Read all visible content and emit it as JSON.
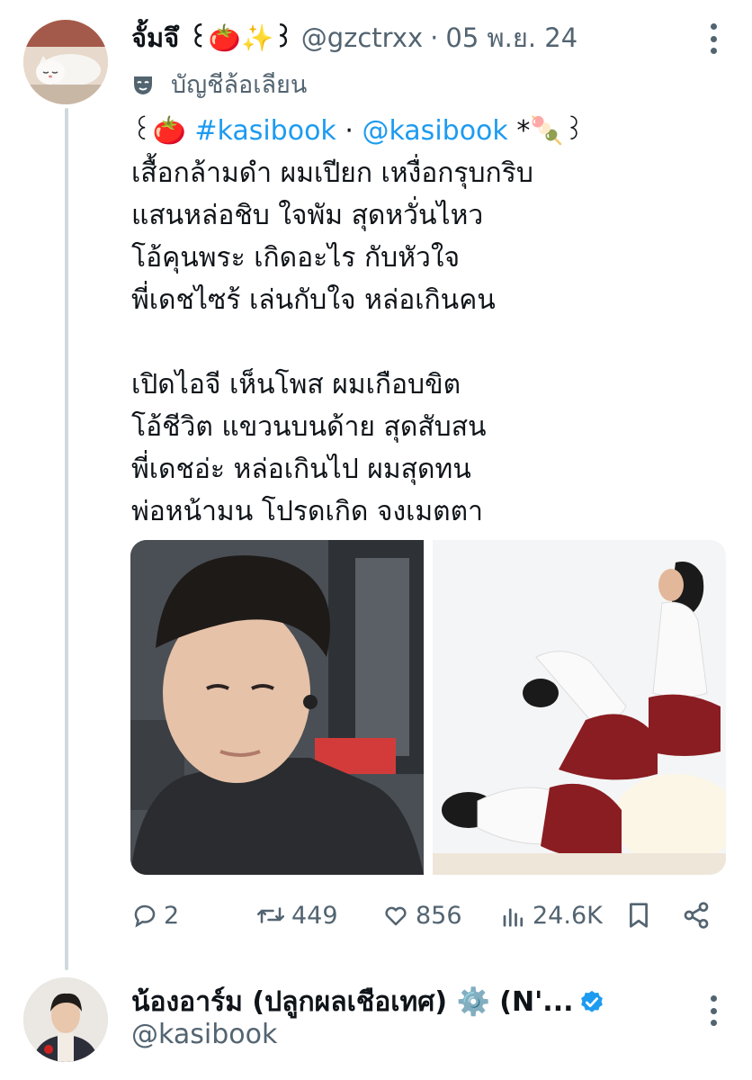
{
  "tweet": {
    "display_name": "จั้มจึ ꒰🍅✨꒱",
    "handle": "@gzctrxx",
    "separator": "·",
    "date": "05 พ.ย. 24",
    "account_label": "บัญชีล้อเลียน",
    "account_label_icon": "parody-mask-icon",
    "intro": {
      "prefix": "꒰🍅",
      "hashtag": "#kasibook",
      "mid": "·",
      "mention": "@kasibook",
      "suffix": "*🍡꒱"
    },
    "lines": [
      "เสื้อกล้ามดำ ผมเปียก เหงื่อกรุบกริบ",
      "แสนหล่อชิบ ใจพัม สุดหวั่นไหว",
      "โอ้คุนพระ เกิดอะไร กับหัวใจ",
      "พี่เดชไซร้ เล่นกับใจ หล่อเกินคน",
      "",
      "เปิดไอจี เห็นโพส ผมเกือบขิต",
      "โอ้ชีวิต แขวนบนด้าย สุดสับสน",
      "พี่เดชอ่ะ หล่อเกินไป ผมสุดทน",
      "พ่อหน้ามน โปรดเกิด จงเมตตา"
    ],
    "stats": {
      "replies": "2",
      "reposts": "449",
      "likes": "856",
      "views": "24.6K"
    }
  },
  "next_tweet": {
    "display_name": "น้องอาร์ม (ปลูกผลเชือเทศ) ⚙️ (N'...",
    "handle": "@kasibook",
    "verified_icon": "verified-badge-icon"
  },
  "colors": {
    "link": "#1d9bf0",
    "secondary_text": "#536471",
    "thread_line": "#cfd9de"
  }
}
